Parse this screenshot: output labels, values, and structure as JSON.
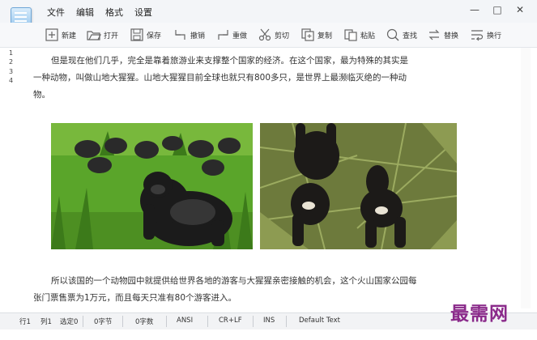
{
  "menu": [
    "文件",
    "编辑",
    "格式",
    "设置"
  ],
  "window_controls": {
    "minimize": "—",
    "maximize": "□",
    "close": "✕"
  },
  "toolbar": {
    "new": "新建",
    "open": "打开",
    "save": "保存",
    "undo": "撤销",
    "redo": "重做",
    "cut": "剪切",
    "copy": "复制",
    "paste": "粘贴",
    "find": "查找",
    "replace": "替换",
    "wrap": "换行"
  },
  "line_numbers": [
    "1",
    "2",
    "3",
    "4"
  ],
  "document": {
    "paragraph1": "但是现在他们几乎，完全是靠着旅游业来支撑整个国家的经济。在这个国家，最为特殊的其实是一种动物，叫做山地大猩猩。山地大猩猩目前全球也就只有800多只，是世界上最濒临灭绝的一种动物。",
    "paragraph2": "所以该国的一个动物园中就提供给世界各地的游客与大猩猩亲密接触的机会，这个火山国家公园每张门票售票为1万元，而且每天只准有80个游客进入。"
  },
  "status": {
    "row": "行1",
    "col": "列1",
    "sel": "选定0",
    "bytes": "0字节",
    "chars": "0字数",
    "encoding": "ANSI",
    "lineend": "CR+LF",
    "mode": "INS",
    "font": "Default Text"
  },
  "watermark": "最需网"
}
